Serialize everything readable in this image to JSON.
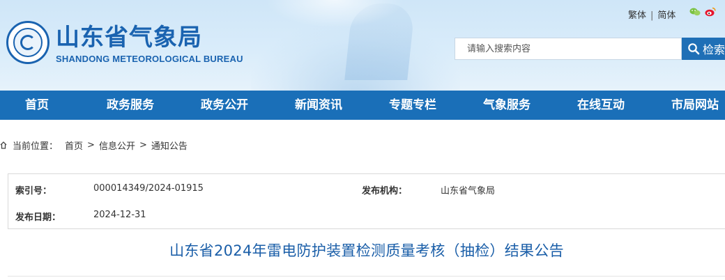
{
  "header": {
    "site_name": "山东省气象局",
    "site_name_en": "SHANDONG METEOROLOGICAL BUREAU",
    "lang_traditional": "繁体",
    "lang_separator": "|",
    "lang_simplified": "简体",
    "social_icons": [
      "wechat-icon",
      "weibo-icon"
    ]
  },
  "search": {
    "placeholder": "请输入搜索内容",
    "button_label": "检索"
  },
  "nav": {
    "items": [
      "首页",
      "政务服务",
      "政务公开",
      "新闻资讯",
      "专题专栏",
      "气象服务",
      "在线互动",
      "市局网站"
    ]
  },
  "breadcrumb": {
    "label": "当前位置：",
    "items": [
      "首页",
      "信息公开",
      "通知公告"
    ],
    "separator": ">"
  },
  "info": {
    "index_label": "索引号：",
    "index_value": "000014349/2024-01915",
    "org_label": "发布机构：",
    "org_value": "山东省气象局",
    "date_label": "发布日期：",
    "date_value": "2024-12-31"
  },
  "article": {
    "title": "山东省2024年雷电防护装置检测质量考核（抽检）结果公告"
  },
  "colors": {
    "brand_blue": "#1a63b0",
    "nav_blue": "#1a6fb8",
    "title_blue": "#1a5ea8"
  }
}
